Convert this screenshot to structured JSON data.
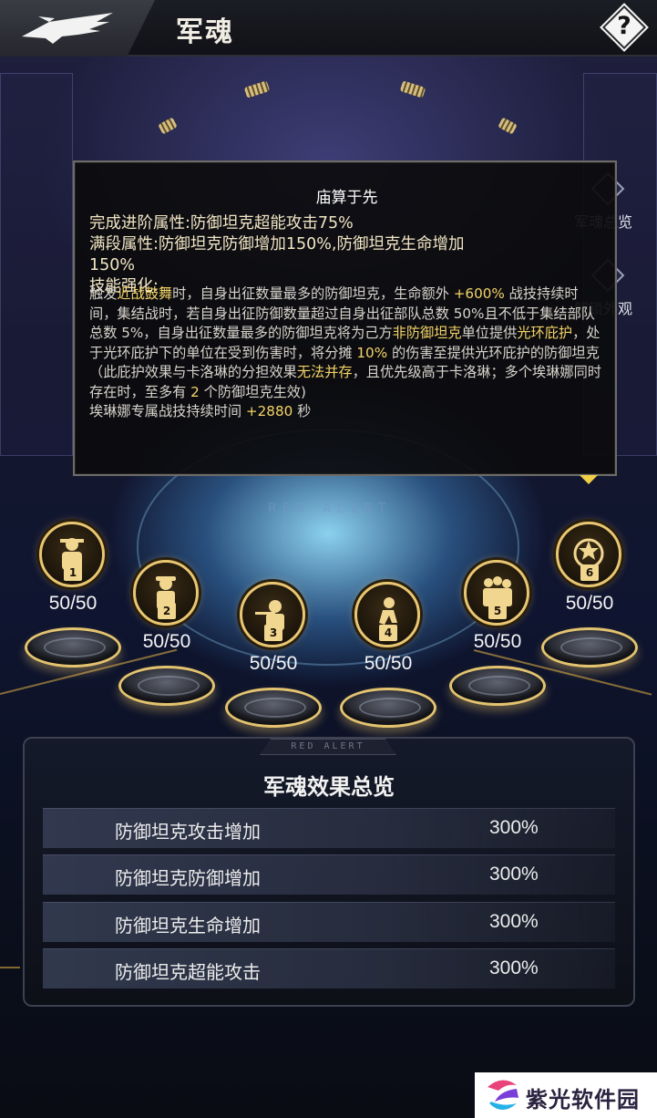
{
  "header": {
    "title": "军魂",
    "help_label": "?"
  },
  "side_buttons": [
    {
      "label": "军魂总览",
      "icon": "overview-icon"
    },
    {
      "label": "解锁外观",
      "icon": "shirt-icon"
    }
  ],
  "tooltip": {
    "title": "庙算于先",
    "line1": "完成进阶属性:防御坦克超能攻击75%",
    "line2": "满段属性:防御坦克防御增加150%,防御坦克生命增加150%",
    "line3": "技能强化:",
    "p_a": "触发",
    "p_b": "近战鼓舞",
    "p_c": "时，自身出征数量最多的防御坦克，生命额外 ",
    "p_d": "+600%",
    "p_e": " 战技持续时间，集结战时，若自身出征防御数量超过自身出征部队总数 50%且不低于集结部队总数 5%，自身出征数量最多的防御坦克将为己方",
    "p_f": "非防御坦克",
    "p_g": "单位提供",
    "p_h": "光环庇护",
    "p_i": "，处于光环庇护下的单位在受到伤害时，将分摊 ",
    "p_j": "10%",
    "p_k": " 的伤害至提供光环庇护的防御坦克（此庇护效果与卡洛琳的分担效果",
    "p_l": "无法并存",
    "p_m": "，且优先级高于卡洛琳；多个埃琳娜同时存在时，至多有 ",
    "p_n": "2",
    "p_o": " 个防御坦克生效)",
    "p_last_a": "埃琳娜专属战技持续时间 ",
    "p_last_b": "+2880",
    "p_last_c": " 秒"
  },
  "background": {
    "watermark_text": "RED ALERT"
  },
  "medals": [
    {
      "id": "1",
      "progress": "50/50",
      "icon": "officer-medal-icon"
    },
    {
      "id": "2",
      "progress": "50/50",
      "icon": "soldier-medal-icon"
    },
    {
      "id": "3",
      "progress": "50/50",
      "icon": "sniper-medal-icon"
    },
    {
      "id": "4",
      "progress": "50/50",
      "icon": "runner-medal-icon"
    },
    {
      "id": "5",
      "progress": "50/50",
      "icon": "squad-medal-icon"
    },
    {
      "id": "6",
      "progress": "50/50",
      "icon": "globe-medal-icon"
    }
  ],
  "summary": {
    "tag": "RED ALERT",
    "title": "军魂效果总览",
    "rows": [
      {
        "label": "防御坦克攻击增加",
        "value": "300%"
      },
      {
        "label": "防御坦克防御增加",
        "value": "300%"
      },
      {
        "label": "防御坦克生命增加",
        "value": "300%"
      },
      {
        "label": "防御坦克超能攻击",
        "value": "300%"
      }
    ]
  },
  "site_watermark": {
    "text": "紫光软件园"
  },
  "colors": {
    "gold": "#e9c671",
    "highlight": "#f4d467",
    "tooltip_bg": "#0c0c0e"
  }
}
